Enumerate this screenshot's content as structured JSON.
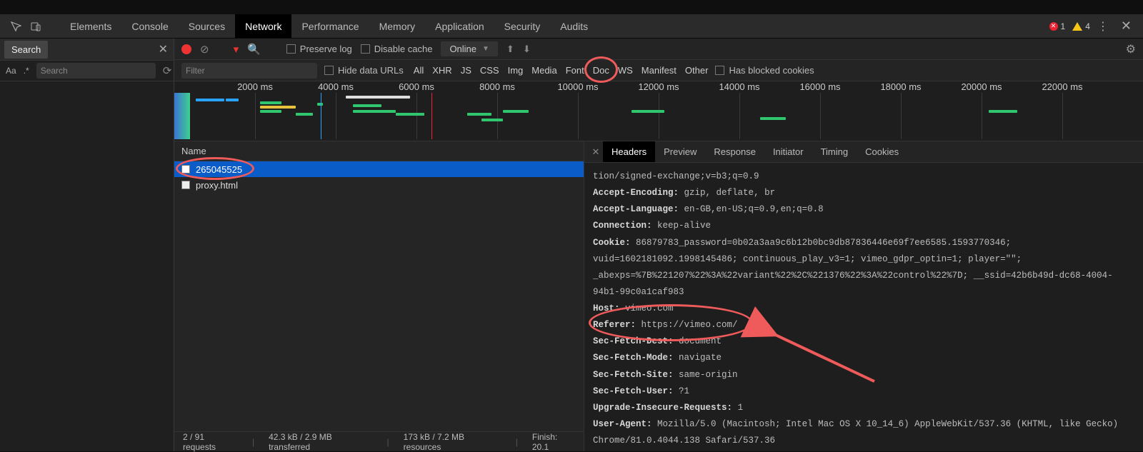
{
  "mainTabs": {
    "items": [
      "Elements",
      "Console",
      "Sources",
      "Network",
      "Performance",
      "Memory",
      "Application",
      "Security",
      "Audits"
    ],
    "activeIndex": 3
  },
  "badges": {
    "errors": "1",
    "warnings": "4"
  },
  "searchDrawer": {
    "title": "Search",
    "aa": "Aa",
    "regex": ".*",
    "placeholder": "Search"
  },
  "netToolbar": {
    "preserveLog": "Preserve log",
    "disableCache": "Disable cache",
    "throttling": "Online"
  },
  "netFilter": {
    "placeholder": "Filter",
    "hideDataUrls": "Hide data URLs",
    "types": [
      "All",
      "XHR",
      "JS",
      "CSS",
      "Img",
      "Media",
      "Font",
      "Doc",
      "WS",
      "Manifest",
      "Other"
    ],
    "hasBlocked": "Has blocked cookies"
  },
  "waterfall": {
    "ticks": [
      "2000 ms",
      "4000 ms",
      "6000 ms",
      "8000 ms",
      "10000 ms",
      "12000 ms",
      "14000 ms",
      "16000 ms",
      "18000 ms",
      "20000 ms",
      "22000 ms"
    ]
  },
  "requestList": {
    "columnHeader": "Name",
    "rows": [
      {
        "name": "265045525",
        "selected": true
      },
      {
        "name": "proxy.html",
        "selected": false
      }
    ]
  },
  "statusBar": {
    "requests": "2 / 91 requests",
    "transferred": "42.3 kB / 2.9 MB transferred",
    "resources": "173 kB / 7.2 MB resources",
    "finish": "Finish: 20.1"
  },
  "detailTabs": {
    "items": [
      "Headers",
      "Preview",
      "Response",
      "Initiator",
      "Timing",
      "Cookies"
    ],
    "activeIndex": 0
  },
  "headers": {
    "line0": "tion/signed-exchange;v=b3;q=0.9",
    "acceptEncoding": {
      "k": "Accept-Encoding:",
      "v": "gzip, deflate, br"
    },
    "acceptLanguage": {
      "k": "Accept-Language:",
      "v": "en-GB,en-US;q=0.9,en;q=0.8"
    },
    "connection": {
      "k": "Connection:",
      "v": "keep-alive"
    },
    "cookie": {
      "k": "Cookie:",
      "v": "86879783_password=0b02a3aa9c6b12b0bc9db87836446e69f7ee6585.1593770346; vuid=1602181092.1998145486; continuous_play_v3=1; vimeo_gdpr_optin=1; player=\"\"; _abexps=%7B%221207%22%3A%22variant%22%2C%221376%22%3A%22control%22%7D; __ssid=42b6b49d-dc68-4004-94b1-99c0a1caf983"
    },
    "host": {
      "k": "Host:",
      "v": "vimeo.com"
    },
    "referer": {
      "k": "Referer:",
      "v": "https://vimeo.com/"
    },
    "secFetchDest": {
      "k": "Sec-Fetch-Dest:",
      "v": "document"
    },
    "secFetchMode": {
      "k": "Sec-Fetch-Mode:",
      "v": "navigate"
    },
    "secFetchSite": {
      "k": "Sec-Fetch-Site:",
      "v": "same-origin"
    },
    "secFetchUser": {
      "k": "Sec-Fetch-User:",
      "v": "?1"
    },
    "upgrade": {
      "k": "Upgrade-Insecure-Requests:",
      "v": "1"
    },
    "userAgent": {
      "k": "User-Agent:",
      "v": "Mozilla/5.0 (Macintosh; Intel Mac OS X 10_14_6) AppleWebKit/537.36 (KHTML, like Gecko) Chrome/81.0.4044.138 Safari/537.36"
    }
  }
}
